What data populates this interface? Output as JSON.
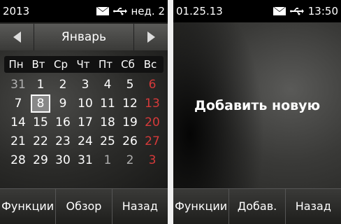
{
  "left": {
    "status": {
      "year": "2013",
      "day_date": "нед. 2"
    },
    "calendar": {
      "month": "Январь",
      "weekdays": [
        "Пн",
        "Вт",
        "Ср",
        "Чт",
        "Пт",
        "Сб",
        "Вс"
      ],
      "weeks": [
        [
          "31",
          "1",
          "2",
          "3",
          "4",
          "5",
          "6"
        ],
        [
          "7",
          "8",
          "9",
          "10",
          "11",
          "12",
          "13"
        ],
        [
          "14",
          "15",
          "16",
          "17",
          "18",
          "19",
          "20"
        ],
        [
          "21",
          "22",
          "23",
          "24",
          "25",
          "26",
          "27"
        ],
        [
          "28",
          "29",
          "30",
          "31",
          "1",
          "2",
          "3"
        ]
      ],
      "selected": "8"
    },
    "softkeys": [
      "Функции",
      "Обзор",
      "Назад"
    ]
  },
  "right": {
    "status": {
      "date": "01.25.13",
      "time": "13:50"
    },
    "message": "Добавить новую",
    "softkeys": [
      "Функции",
      "Добав.",
      "Назад"
    ]
  },
  "colors": {
    "sunday": "#d63a3a",
    "other_month": "#b0b0b0",
    "divider": "#f0f0f0"
  }
}
